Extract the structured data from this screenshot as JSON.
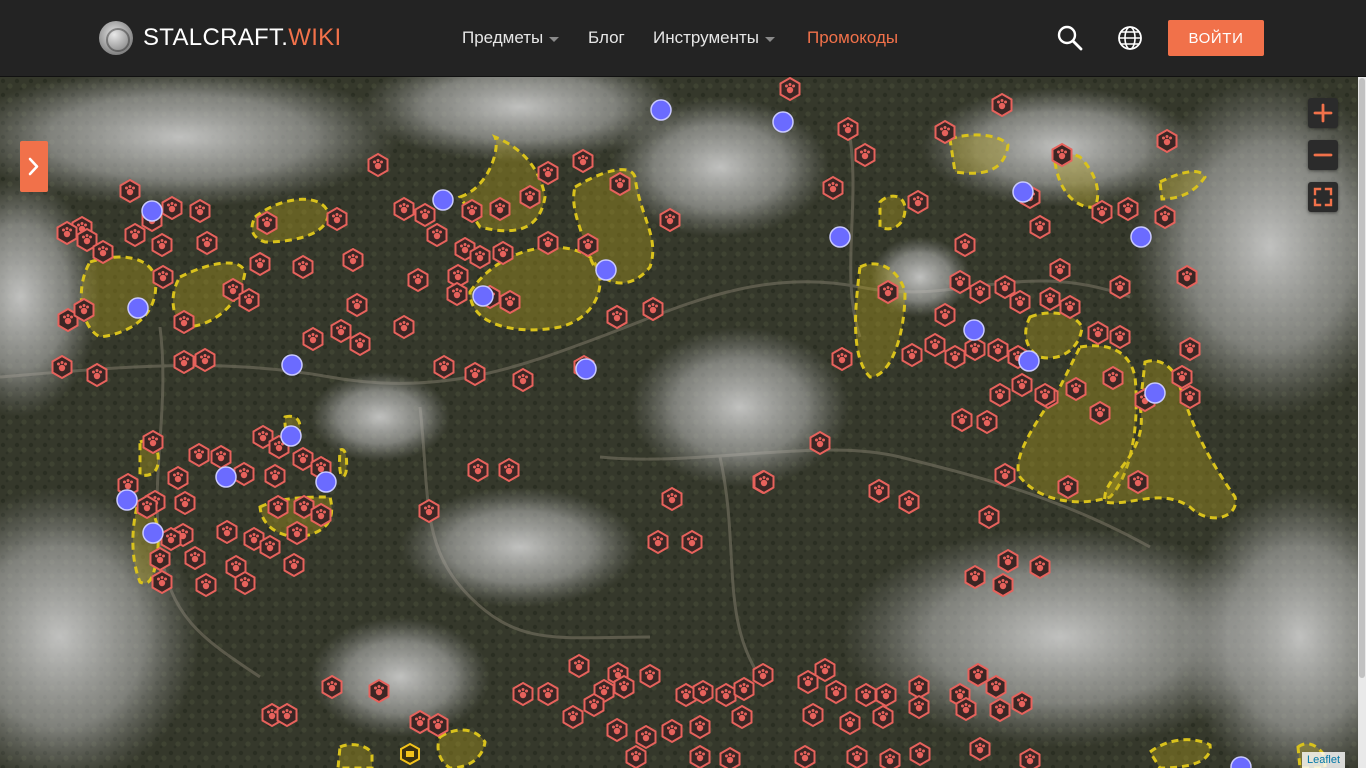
{
  "header": {
    "logo": {
      "main": "STALCRAFT.",
      "accent": "WIKI",
      "icon": "globe-logo-icon"
    },
    "nav": [
      {
        "label": "Предметы",
        "has_dropdown": true,
        "active": false
      },
      {
        "label": "Блог",
        "has_dropdown": false,
        "active": false
      },
      {
        "label": "Инструменты",
        "has_dropdown": true,
        "active": false
      },
      {
        "label": "Промокоды",
        "has_dropdown": false,
        "active": true
      }
    ],
    "search_icon": "search-icon",
    "language_icon": "globe-icon",
    "login_label": "ВОЙТИ"
  },
  "map": {
    "controls": {
      "zoom_in": "+",
      "zoom_out": "−",
      "fullscreen": "fullscreen-icon",
      "sidebar_toggle": "chevron-right-icon"
    },
    "attribution": "Leaflet",
    "colors": {
      "accent": "#f1714a",
      "marker_fill": "#3b2624",
      "marker_stroke": "#e7625c",
      "player_marker": "#6b6bff",
      "zone_stroke": "#d9c21c"
    }
  }
}
